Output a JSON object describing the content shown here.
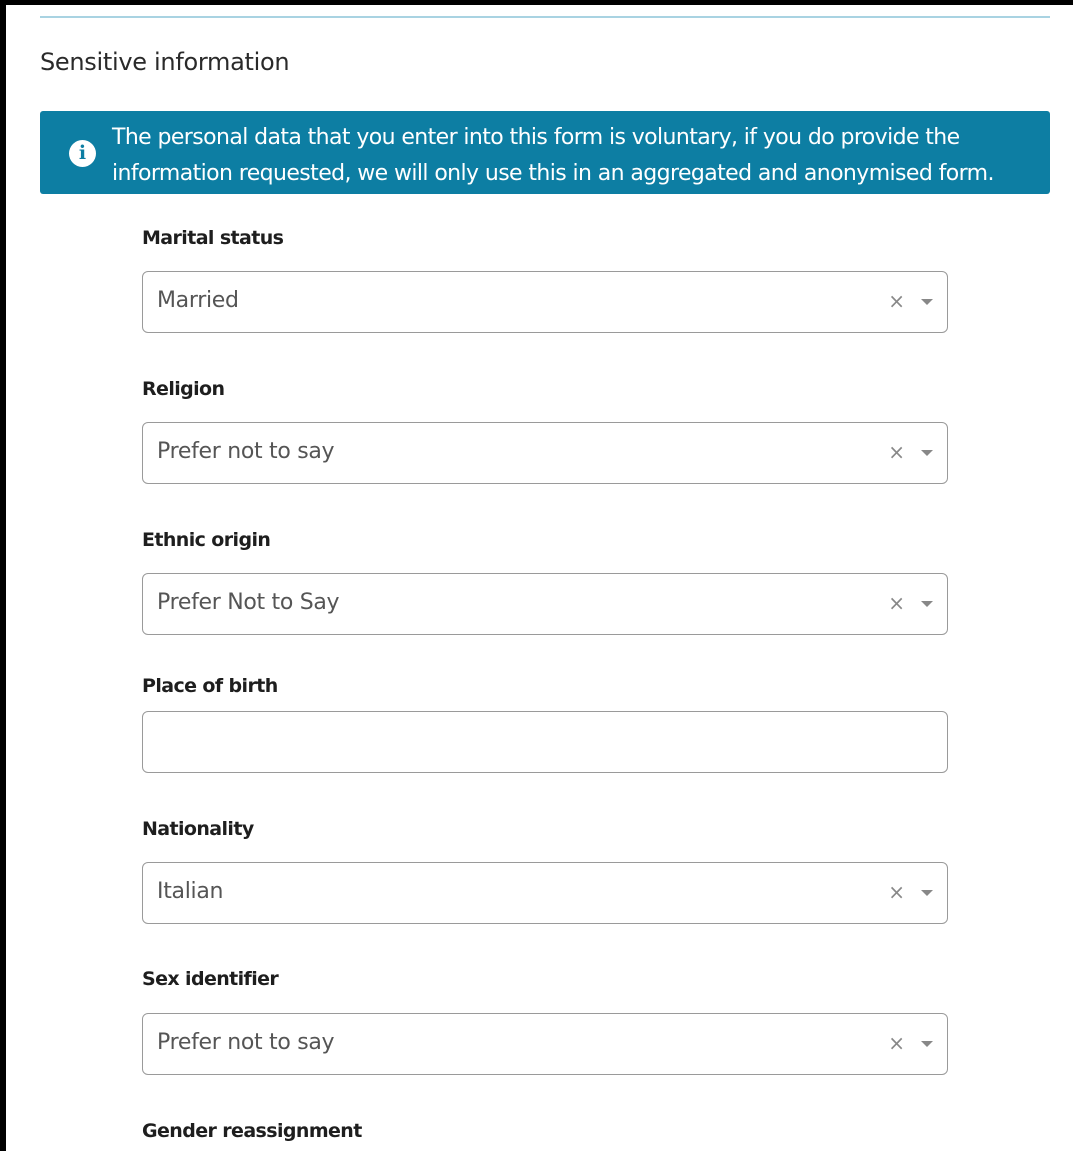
{
  "section": {
    "title": "Sensitive information"
  },
  "info_banner": {
    "icon": "info-icon",
    "icon_glyph": "i",
    "line1": "The personal data that you enter into this form is voluntary, if you do provide the",
    "line2": "information requested, we will only use this in an aggregated and anonymised form.",
    "background_color": "#0d7ea3"
  },
  "fields": {
    "marital_status": {
      "label": "Marital status",
      "value": "Married"
    },
    "religion": {
      "label": "Religion",
      "value": "Prefer not to say"
    },
    "ethnic_origin": {
      "label": "Ethnic origin",
      "value": "Prefer Not to Say"
    },
    "place_of_birth": {
      "label": "Place of birth",
      "value": ""
    },
    "nationality": {
      "label": "Nationality",
      "value": "Italian"
    },
    "sex_identifier": {
      "label": "Sex identifier",
      "value": "Prefer not to say"
    },
    "gender_reassignment": {
      "label": "Gender reassignment"
    }
  },
  "controls": {
    "clear_glyph": "×",
    "clear_icon": "close-icon",
    "caret_icon": "caret-down-icon"
  }
}
